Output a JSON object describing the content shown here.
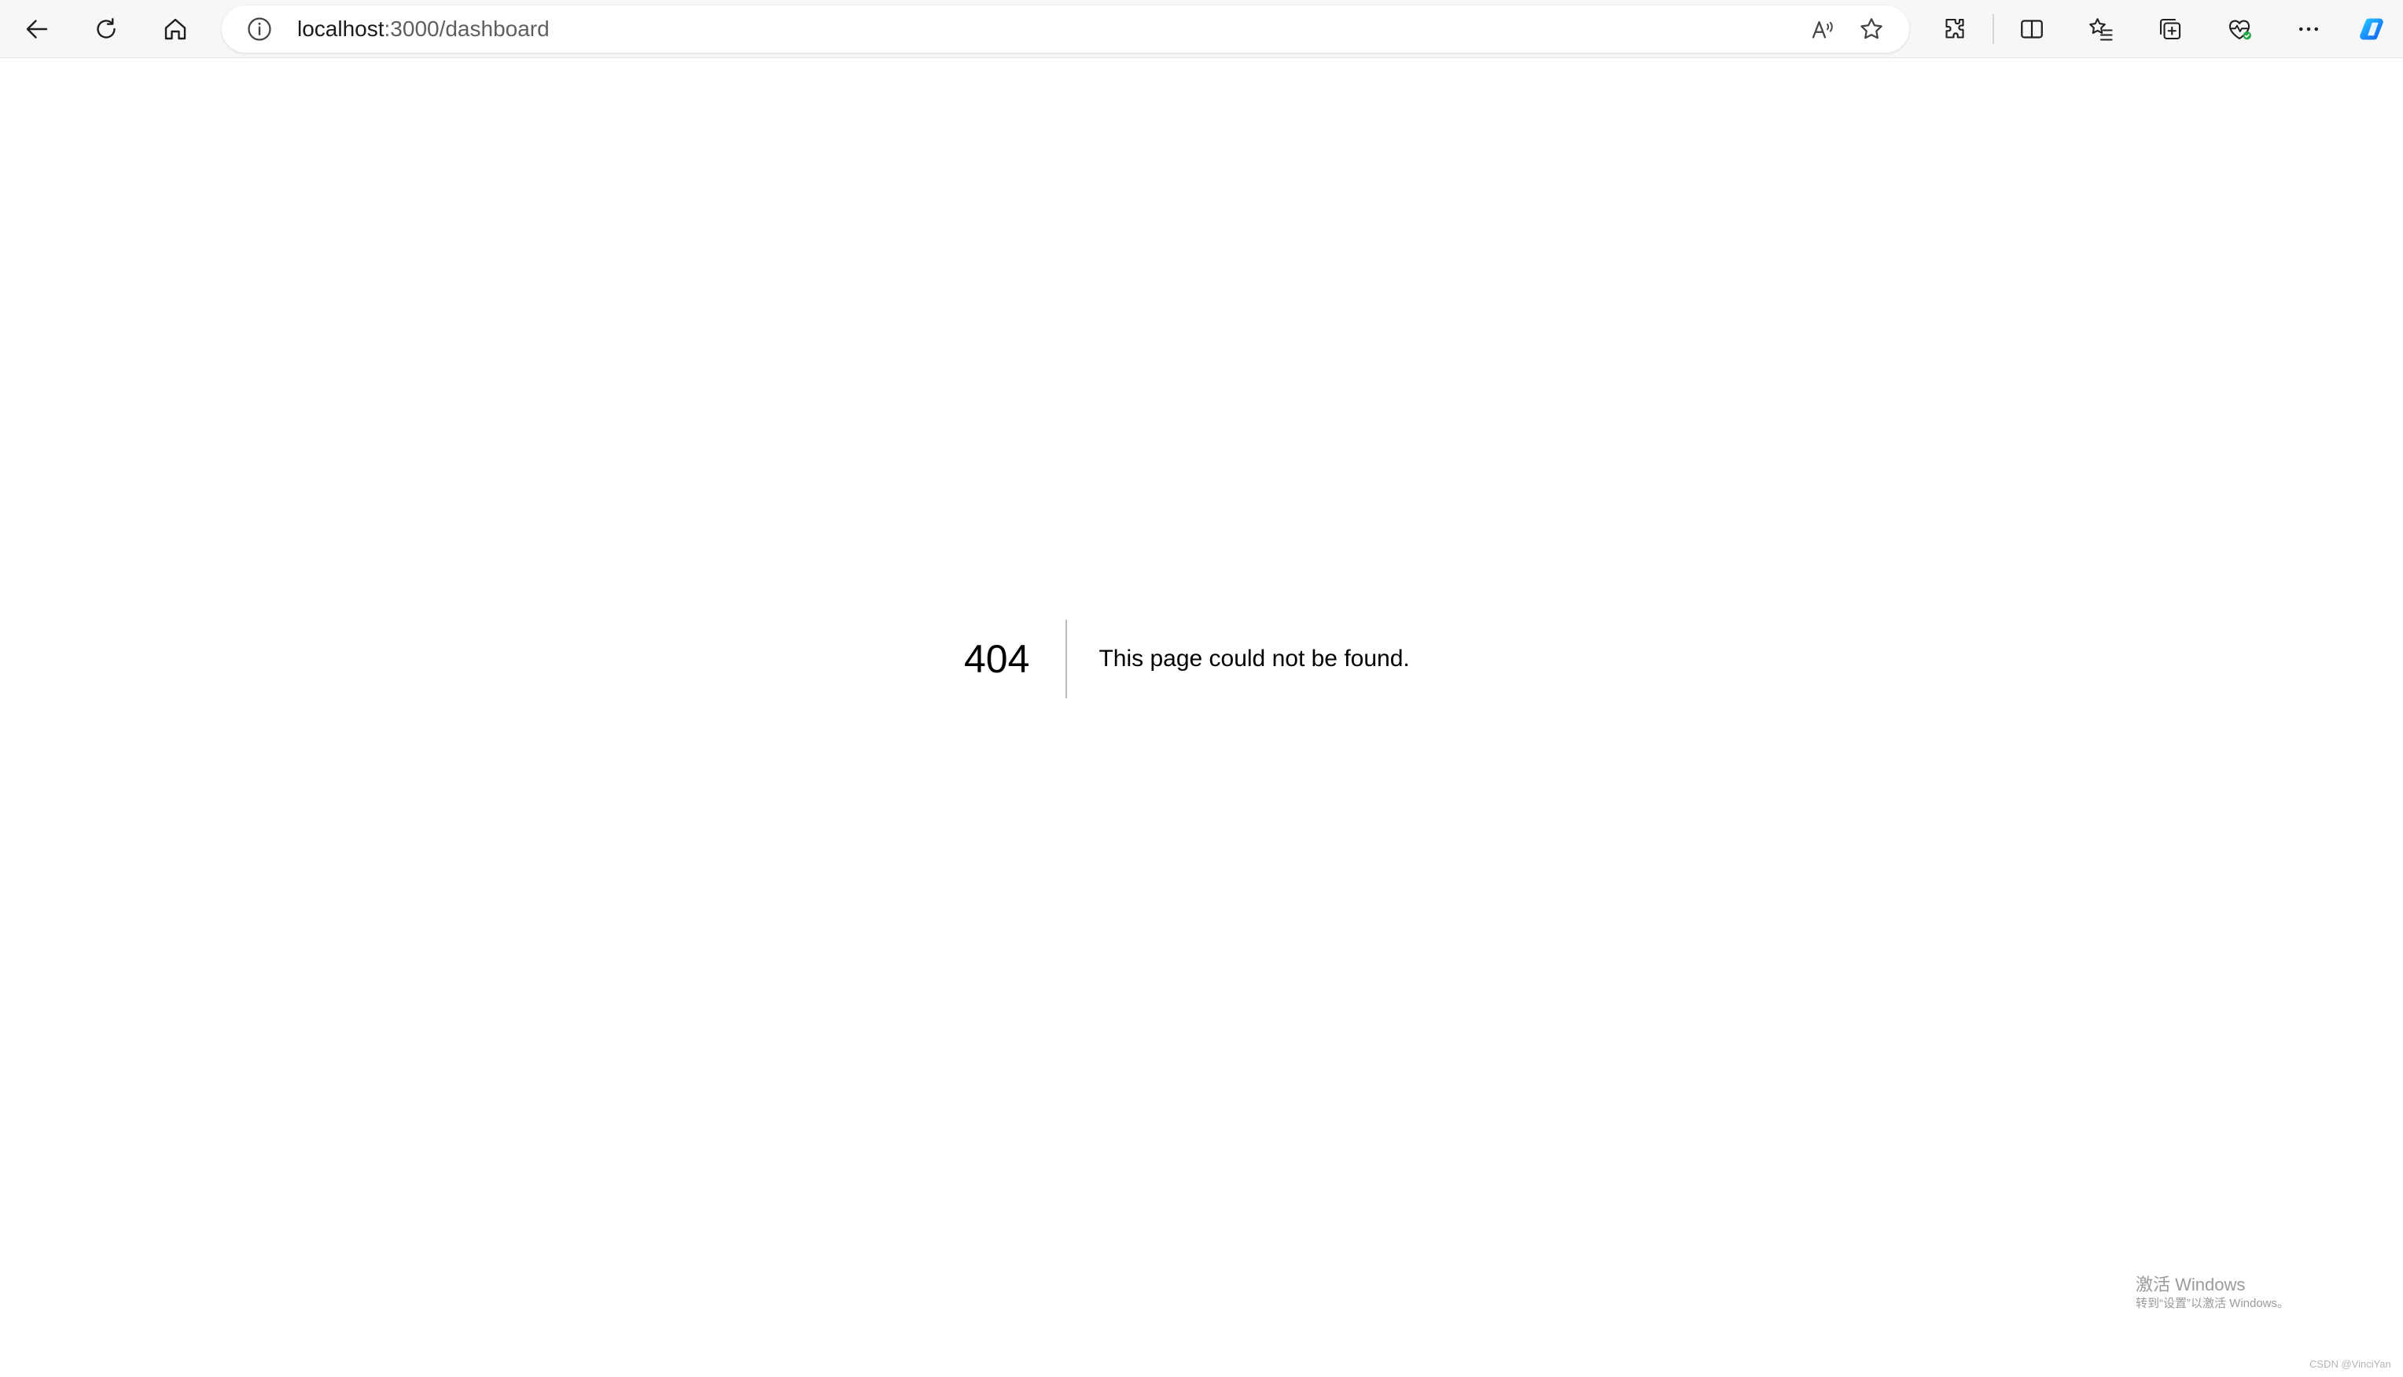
{
  "browser": {
    "address_host": "localhost",
    "address_rest": ":3000/dashboard",
    "icons": {
      "back": "arrow-left-icon",
      "refresh": "refresh-icon",
      "home": "home-icon",
      "info": "info-icon",
      "read_aloud": "read-aloud-icon",
      "favorite": "star-icon",
      "extensions": "extensions-icon",
      "split_screen": "split-screen-icon",
      "favorites": "favorites-icon",
      "collections": "collections-icon",
      "browser_essentials": "heart-pulse-icon",
      "more": "more-icon",
      "copilot": "copilot-icon"
    }
  },
  "page": {
    "error_code": "404",
    "error_message": "This page could not be found."
  },
  "watermark": {
    "title": "激活 Windows",
    "subtitle": "转到“设置”以激活 Windows。"
  },
  "credit": "CSDN @VinciYan",
  "colors": {
    "toolbar_bg": "#f7f7f7",
    "page_bg": "#ffffff",
    "divider": "#bdbdbd",
    "copilot_accent": "#1a8cff",
    "status_green": "#22a745"
  }
}
